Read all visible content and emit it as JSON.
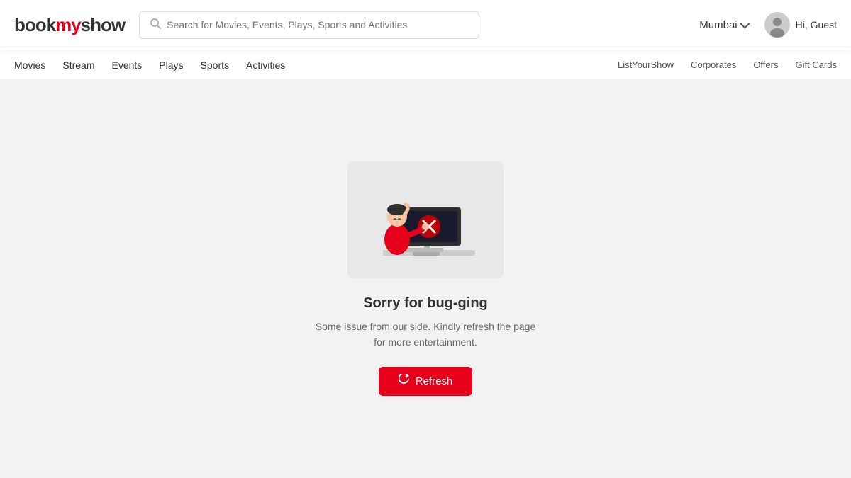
{
  "header": {
    "logo": "bookmyshow",
    "search_placeholder": "Search for Movies, Events, Plays, Sports and Activities",
    "city": "Mumbai",
    "user_greeting": "Hi, Guest"
  },
  "nav": {
    "left_items": [
      {
        "label": "Movies",
        "id": "movies"
      },
      {
        "label": "Stream",
        "id": "stream"
      },
      {
        "label": "Events",
        "id": "events"
      },
      {
        "label": "Plays",
        "id": "plays"
      },
      {
        "label": "Sports",
        "id": "sports"
      },
      {
        "label": "Activities",
        "id": "activities"
      }
    ],
    "right_items": [
      {
        "label": "ListYourShow",
        "id": "listyourshow"
      },
      {
        "label": "Corporates",
        "id": "corporates"
      },
      {
        "label": "Offers",
        "id": "offers"
      },
      {
        "label": "Gift Cards",
        "id": "giftcards"
      }
    ]
  },
  "error_page": {
    "title": "Sorry for bug-ging",
    "subtitle": "Some issue from our side. Kindly refresh the page for more entertainment.",
    "refresh_label": "Refresh"
  }
}
